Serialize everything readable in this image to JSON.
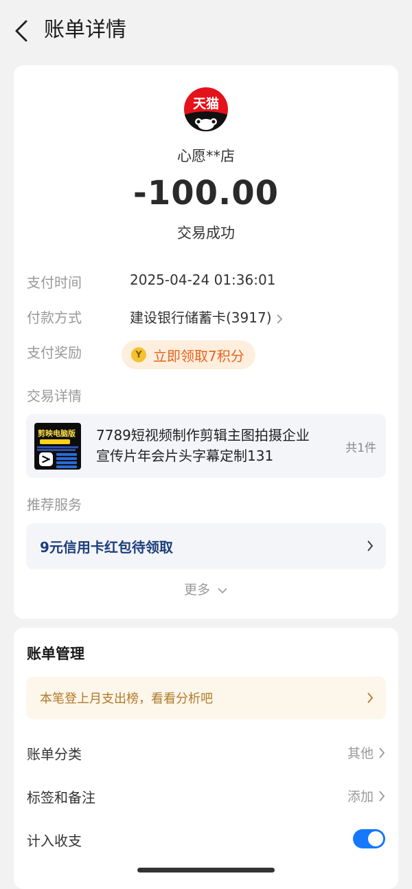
{
  "header": {
    "title": "账单详情",
    "back_icon": "chevron-left-icon"
  },
  "summary": {
    "logo_text": "天猫",
    "logo_icon": "tmall-logo",
    "merchant": "心愿**店",
    "amount": "-100.00",
    "status": "交易成功"
  },
  "details": {
    "pay_time_label": "支付时间",
    "pay_time_value": "2025-04-24 01:36:01",
    "pay_method_label": "付款方式",
    "pay_method_value": "建设银行储蓄卡(3917)",
    "reward_label": "支付奖励",
    "reward_text": "立即领取7积分",
    "reward_icon_text": "Y",
    "trade_detail_label": "交易详情"
  },
  "product": {
    "thumb_title": "剪映电脑版",
    "name": "7789短视频制作剪辑主图拍摄企业宣传片年会片头字幕定制131",
    "count": "共1件"
  },
  "recommend": {
    "label": "推荐服务",
    "promo_text": "9元信用卡红包待领取",
    "more_label": "更多"
  },
  "bill_management": {
    "title": "账单管理",
    "insight_text": "本笔登上月支出榜，看看分析吧",
    "category_label": "账单分类",
    "category_value": "其他",
    "tags_label": "标签和备注",
    "tags_value": "添加",
    "include_label": "计入收支",
    "include_enabled": true
  },
  "colors": {
    "accent": "#1677ff",
    "reward": "#e8641c",
    "promo": "#1d3d7a",
    "insight": "#b07a2a",
    "tmall_red": "#e4121b"
  }
}
